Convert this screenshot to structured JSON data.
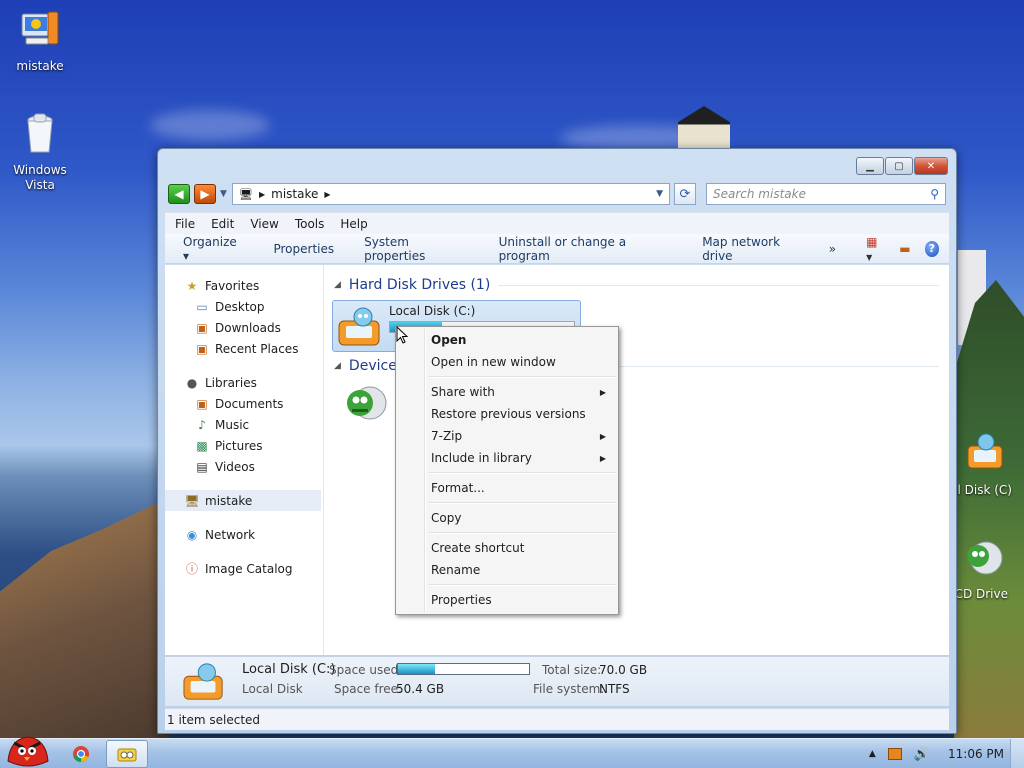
{
  "desktop": {
    "icons": [
      {
        "label": "mistake"
      },
      {
        "label": "Windows\nVista"
      },
      {
        "label": "al Disk (C)"
      },
      {
        "label": "CD Drive"
      }
    ]
  },
  "window": {
    "address": {
      "segment": "mistake"
    },
    "search": {
      "placeholder": "Search mistake"
    },
    "menu": [
      "File",
      "Edit",
      "View",
      "Tools",
      "Help"
    ],
    "commands": [
      "Organize ▾",
      "Properties",
      "System properties",
      "Uninstall or change a program",
      "Map network drive",
      "»"
    ],
    "nav": {
      "favorites": "Favorites",
      "favorites_items": [
        "Desktop",
        "Downloads",
        "Recent Places"
      ],
      "libraries": "Libraries",
      "libraries_items": [
        "Documents",
        "Music",
        "Pictures",
        "Videos"
      ],
      "computer": "mistake",
      "network": "Network",
      "image_catalog": "Image Catalog"
    },
    "content": {
      "hdd_header": "Hard Disk Drives (1)",
      "drive_name": "Local Disk (C:)",
      "drive_used_fraction": 0.28,
      "devices_header": "Devices"
    },
    "details": {
      "name": "Local Disk (C:)",
      "type": "Local Disk",
      "space_used_label": "Space used:",
      "space_used_fraction": 0.28,
      "space_free_label": "Space free:",
      "space_free_value": "50.4 GB",
      "total_size_label": "Total size:",
      "total_size_value": "70.0 GB",
      "fs_label": "File system:",
      "fs_value": "NTFS"
    },
    "status": "1 item selected"
  },
  "context_menu": {
    "items": [
      {
        "label": "Open",
        "bold": true
      },
      {
        "label": "Open in new window"
      },
      {
        "sep": true
      },
      {
        "label": "Share with",
        "submenu": true
      },
      {
        "label": "Restore previous versions"
      },
      {
        "label": "7-Zip",
        "submenu": true
      },
      {
        "label": "Include in library",
        "submenu": true
      },
      {
        "sep": true
      },
      {
        "label": "Format..."
      },
      {
        "sep": true
      },
      {
        "label": "Copy"
      },
      {
        "sep": true
      },
      {
        "label": "Create shortcut"
      },
      {
        "label": "Rename"
      },
      {
        "sep": true
      },
      {
        "label": "Properties"
      }
    ]
  },
  "taskbar": {
    "clock": "11:06 PM"
  },
  "colors": {
    "accent": "#1e3c8c",
    "selection": "#c3dbf4"
  }
}
